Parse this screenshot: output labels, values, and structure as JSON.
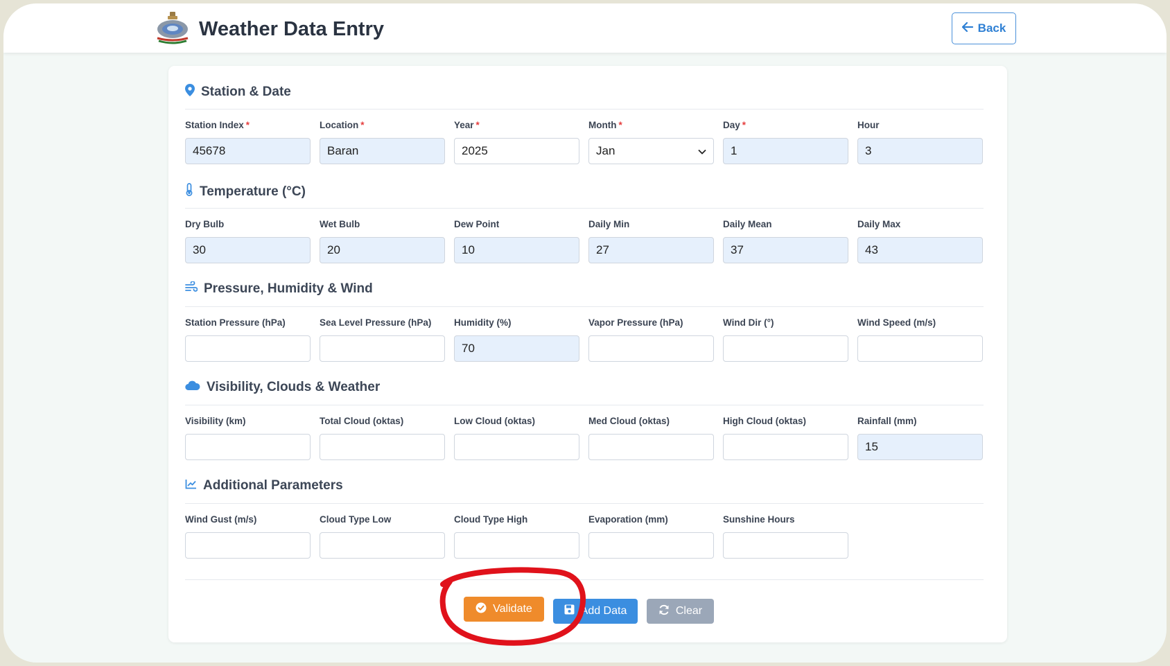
{
  "header": {
    "title": "Weather Data Entry",
    "back_label": "Back"
  },
  "sections": {
    "station": {
      "title": "Station & Date",
      "fields": {
        "station_index": {
          "label": "Station Index",
          "value": "45678"
        },
        "location": {
          "label": "Location",
          "value": "Baran"
        },
        "year": {
          "label": "Year",
          "value": "2025"
        },
        "month": {
          "label": "Month",
          "value": "Jan"
        },
        "day": {
          "label": "Day",
          "value": "1"
        },
        "hour": {
          "label": "Hour",
          "value": "3"
        }
      }
    },
    "temperature": {
      "title": "Temperature (°C)",
      "fields": {
        "dry_bulb": {
          "label": "Dry Bulb",
          "value": "30"
        },
        "wet_bulb": {
          "label": "Wet Bulb",
          "value": "20"
        },
        "dew_point": {
          "label": "Dew Point",
          "value": "10"
        },
        "daily_min": {
          "label": "Daily Min",
          "value": "27"
        },
        "daily_mean": {
          "label": "Daily Mean",
          "value": "37"
        },
        "daily_max": {
          "label": "Daily Max",
          "value": "43"
        }
      }
    },
    "pressure": {
      "title": "Pressure, Humidity & Wind",
      "fields": {
        "station_pressure": {
          "label": "Station Pressure (hPa)",
          "value": ""
        },
        "sea_level_pressure": {
          "label": "Sea Level Pressure (hPa)",
          "value": ""
        },
        "humidity": {
          "label": "Humidity (%)",
          "value": "70"
        },
        "vapor_pressure": {
          "label": "Vapor Pressure (hPa)",
          "value": ""
        },
        "wind_dir": {
          "label": "Wind Dir (°)",
          "value": ""
        },
        "wind_speed": {
          "label": "Wind Speed (m/s)",
          "value": ""
        }
      }
    },
    "visibility": {
      "title": "Visibility, Clouds & Weather",
      "fields": {
        "visibility": {
          "label": "Visibility (km)",
          "value": ""
        },
        "total_cloud": {
          "label": "Total Cloud (oktas)",
          "value": ""
        },
        "low_cloud": {
          "label": "Low Cloud (oktas)",
          "value": ""
        },
        "med_cloud": {
          "label": "Med Cloud (oktas)",
          "value": ""
        },
        "high_cloud": {
          "label": "High Cloud (oktas)",
          "value": ""
        },
        "rainfall": {
          "label": "Rainfall (mm)",
          "value": "15"
        }
      }
    },
    "additional": {
      "title": "Additional Parameters",
      "fields": {
        "wind_gust": {
          "label": "Wind Gust (m/s)",
          "value": ""
        },
        "cloud_type_low": {
          "label": "Cloud Type Low",
          "value": ""
        },
        "cloud_type_high": {
          "label": "Cloud Type High",
          "value": ""
        },
        "evaporation": {
          "label": "Evaporation (mm)",
          "value": ""
        },
        "sunshine_hours": {
          "label": "Sunshine Hours",
          "value": ""
        }
      }
    }
  },
  "actions": {
    "validate_label": "Validate",
    "add_label": "Add Data",
    "clear_label": "Clear"
  },
  "colors": {
    "accent_blue": "#3b8ee0",
    "validate_orange": "#ef8b2b",
    "clear_gray": "#9ba7b8",
    "filled_input": "#e6f0fc",
    "annotation_red": "#e0121b"
  }
}
